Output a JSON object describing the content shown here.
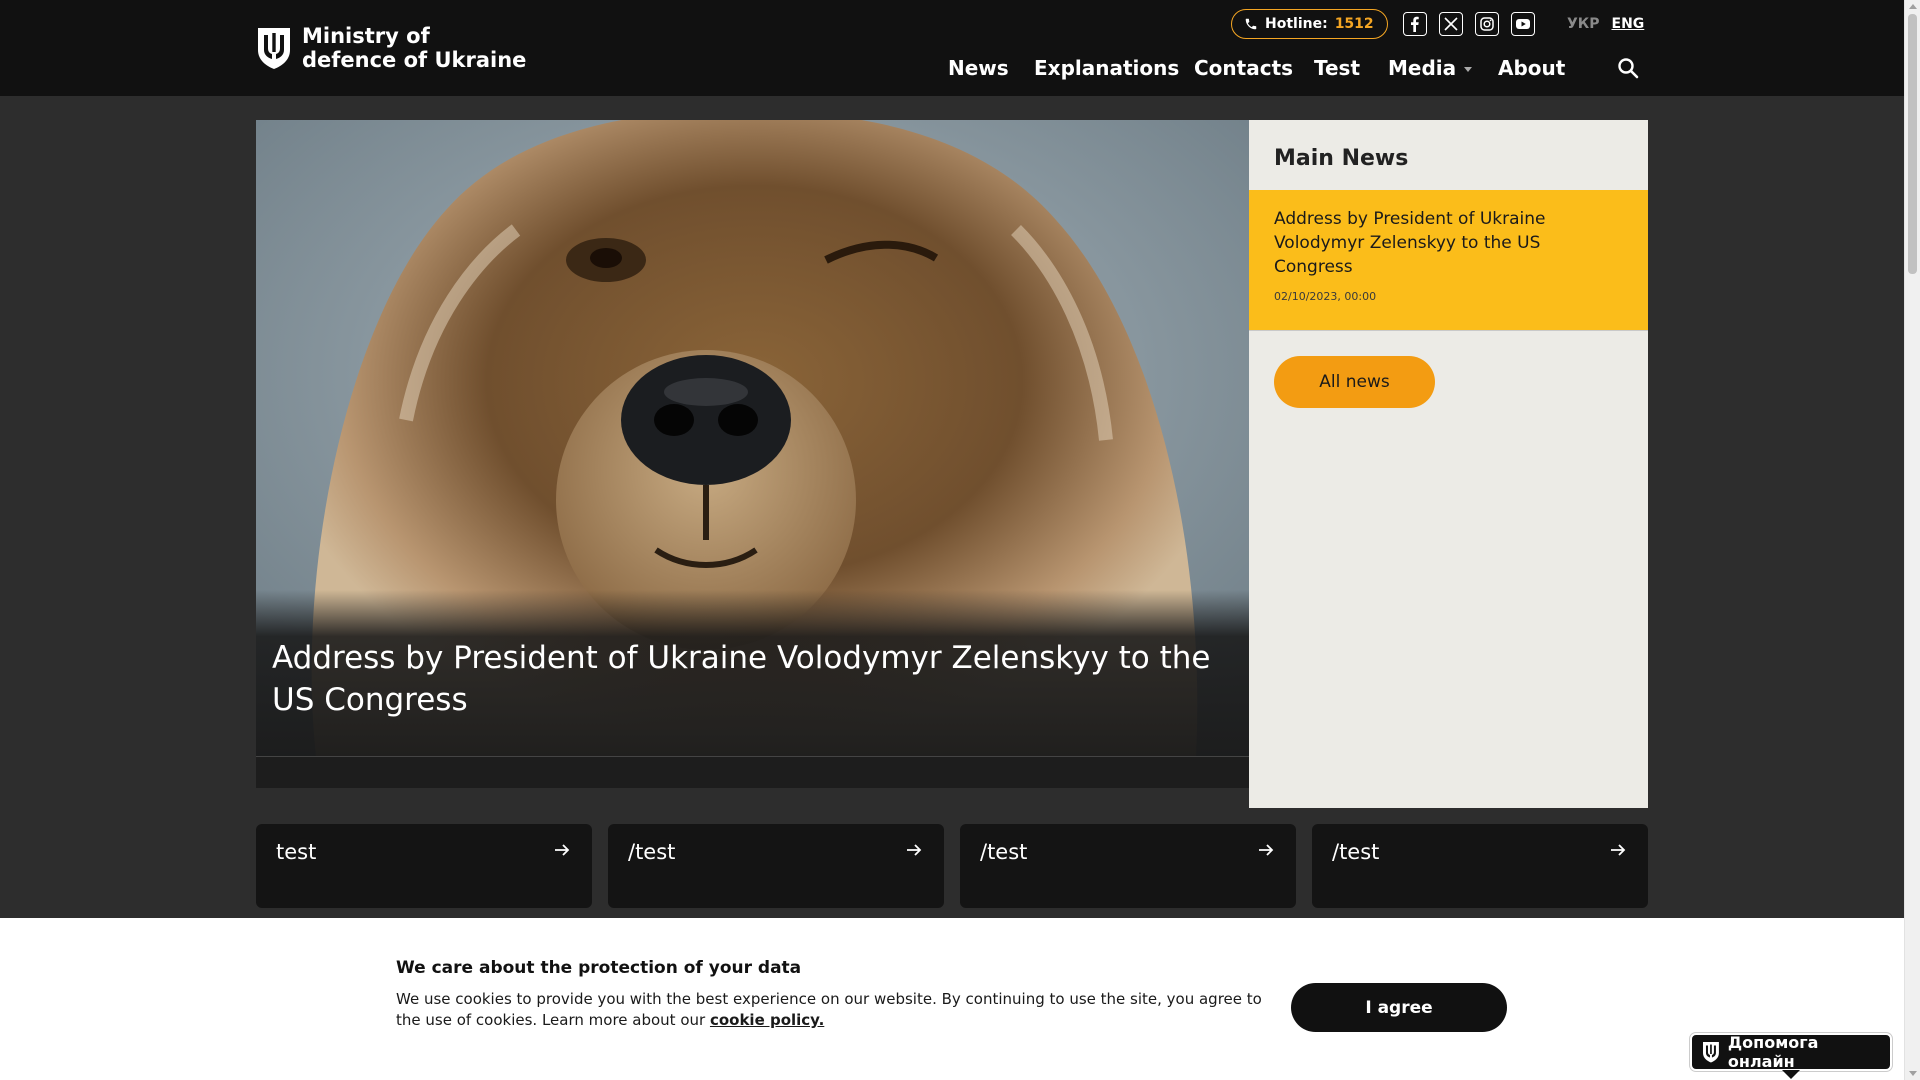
{
  "header": {
    "logo_line1": "Ministry of",
    "logo_line2": "defence of Ukraine",
    "hotline_label": "Hotline:",
    "hotline_number": "1512",
    "socials": [
      "facebook-icon",
      "x-twitter-icon",
      "instagram-icon",
      "youtube-icon"
    ],
    "lang_ukr": "УКР",
    "lang_eng": "ENG",
    "nav": [
      "News",
      "Explanations",
      "Contacts",
      "Test",
      "Media",
      "About"
    ]
  },
  "hero": {
    "title": "Address by President of Ukraine Volodymyr Zelenskyy to the US Congress"
  },
  "main_news": {
    "title": "Main News",
    "item_title": "Address by President of Ukraine Volodymyr Zelenskyy to the US Congress",
    "item_date": "02/10/2023, 00:00",
    "all_news_label": "All news"
  },
  "tiles": [
    "test",
    "/test",
    "/test",
    "/test"
  ],
  "cookie": {
    "title": "We care about the protection of your data",
    "text": "We use cookies to provide you with the best experience on our website. By continuing to use the site, you agree to the use of cookies. Learn more about our ",
    "link": "cookie policy.",
    "agree_label": "I agree"
  },
  "help_online": "Допомога онлайн",
  "colors": {
    "accent_orange": "#f39c12",
    "accent_yellow": "#fbbd1a",
    "header_bg": "#111111",
    "page_bg": "#2d2d2d"
  }
}
